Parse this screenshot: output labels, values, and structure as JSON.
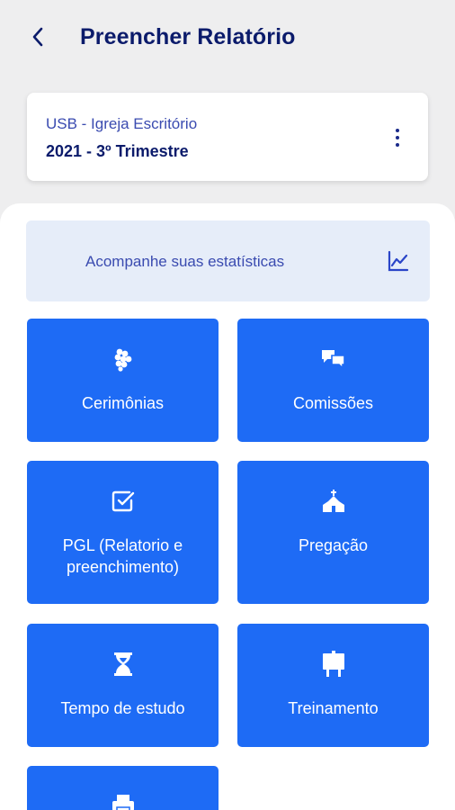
{
  "header": {
    "title": "Preencher Relatório"
  },
  "org_card": {
    "name": "USB - Igreja Escritório",
    "period": "2021 - 3º Trimestre"
  },
  "stats_banner": {
    "label": "Acompanhe suas estatísticas"
  },
  "tiles": [
    {
      "label": "Cerimônias",
      "icon": "grapes-icon"
    },
    {
      "label": "Comissões",
      "icon": "chat-bubbles-icon"
    },
    {
      "label": "PGL (Relatorio e preenchimento)",
      "icon": "checkbox-icon"
    },
    {
      "label": "Pregação",
      "icon": "church-icon"
    },
    {
      "label": "Tempo de estudo",
      "icon": "hourglass-icon"
    },
    {
      "label": "Treinamento",
      "icon": "easel-icon"
    },
    {
      "label": "",
      "icon": "printer-icon"
    }
  ],
  "colors": {
    "primary": "#1e6bf5",
    "title": "#0b1b6b",
    "banner_bg": "#e6edf9",
    "background": "#eeeeef"
  }
}
